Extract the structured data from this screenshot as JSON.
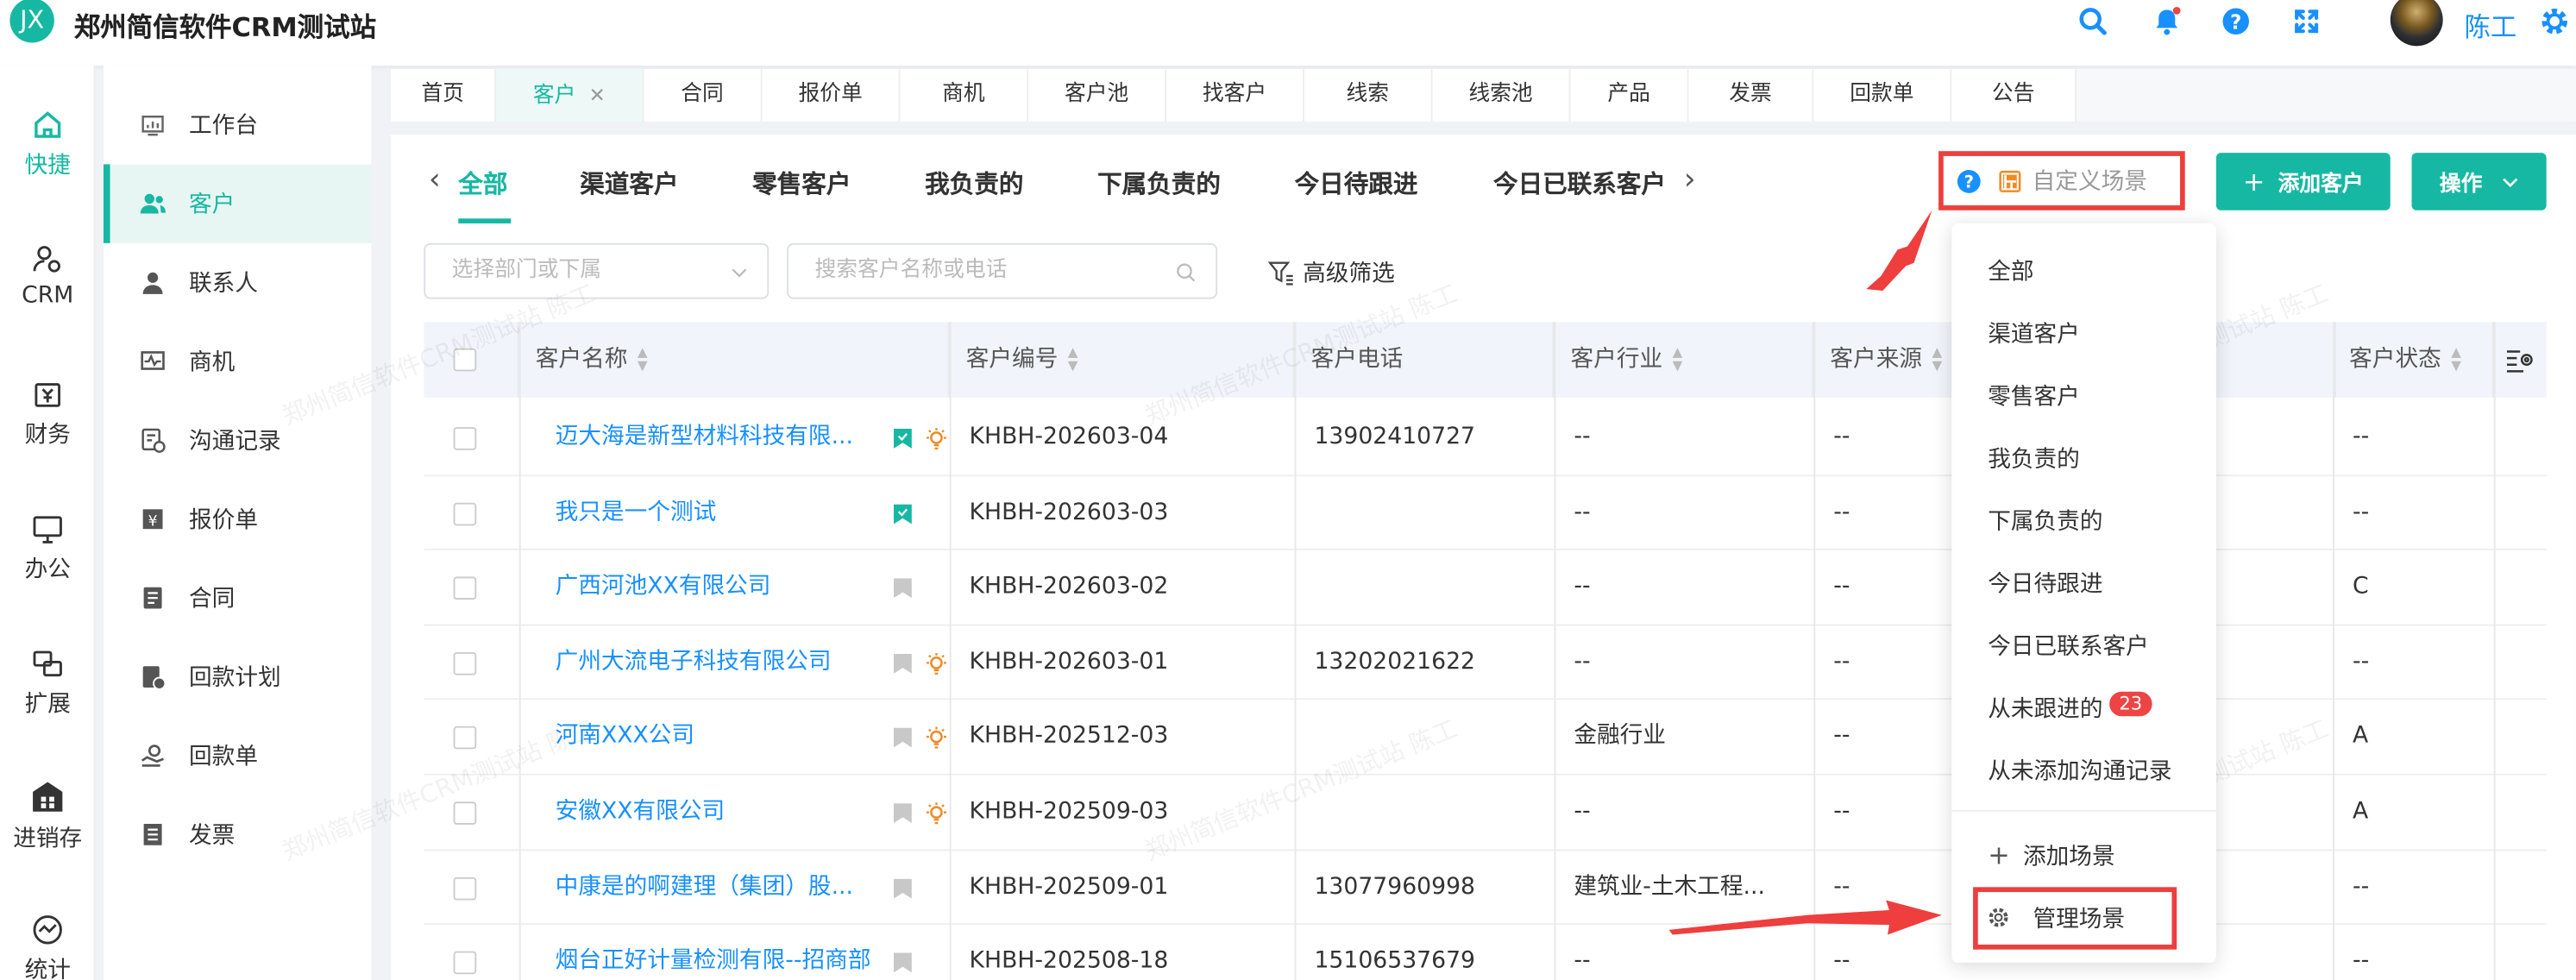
{
  "app": {
    "logo_text": "JX",
    "title": "郑州简信软件CRM测试站",
    "user_name": "陈工"
  },
  "rail": [
    {
      "label": "快捷",
      "icon": "home-icon"
    },
    {
      "label": "CRM",
      "icon": "crm-user-icon"
    },
    {
      "label": "财务",
      "icon": "finance-icon"
    },
    {
      "label": "办公",
      "icon": "monitor-icon"
    },
    {
      "label": "扩展",
      "icon": "extend-icon"
    },
    {
      "label": "进销存",
      "icon": "store-icon"
    },
    {
      "label": "统计",
      "icon": "stats-icon"
    }
  ],
  "menu": [
    {
      "label": "工作台"
    },
    {
      "label": "客户"
    },
    {
      "label": "联系人"
    },
    {
      "label": "商机"
    },
    {
      "label": "沟通记录"
    },
    {
      "label": "报价单"
    },
    {
      "label": "合同"
    },
    {
      "label": "回款计划"
    },
    {
      "label": "回款单"
    },
    {
      "label": "发票"
    }
  ],
  "tabs": [
    {
      "label": "首页"
    },
    {
      "label": "客户"
    },
    {
      "label": "合同"
    },
    {
      "label": "报价单"
    },
    {
      "label": "商机"
    },
    {
      "label": "客户池"
    },
    {
      "label": "找客户"
    },
    {
      "label": "线索"
    },
    {
      "label": "线索池"
    },
    {
      "label": "产品"
    },
    {
      "label": "发票"
    },
    {
      "label": "回款单"
    },
    {
      "label": "公告"
    }
  ],
  "scenes": [
    "全部",
    "渠道客户",
    "零售客户",
    "我负责的",
    "下属负责的",
    "今日待跟进",
    "今日已联系客户"
  ],
  "toolbar": {
    "custom_scene": "自定义场景",
    "add_customer": "添加客户",
    "actions": "操作"
  },
  "filters": {
    "dept_placeholder": "选择部门或下属",
    "search_placeholder": "搜索客户名称或电话",
    "advanced": "高级筛选"
  },
  "columns": [
    "客户名称",
    "客户编号",
    "客户电话",
    "客户行业",
    "客户来源",
    "客户状态"
  ],
  "rows": [
    {
      "name": "迈大海是新型材料科技有限...",
      "code": "KHBH-202603-04",
      "phone": "13902410727",
      "industry": "--",
      "source": "--",
      "status": "--",
      "flagged": true,
      "bulb": true
    },
    {
      "name": "我只是一个测试",
      "code": "KHBH-202603-03",
      "phone": "",
      "industry": "--",
      "source": "--",
      "status": "--",
      "flagged": true,
      "bulb": false
    },
    {
      "name": "广西河池XX有限公司",
      "code": "KHBH-202603-02",
      "phone": "",
      "industry": "--",
      "source": "--",
      "status": "C",
      "flagged": false,
      "bulb": false
    },
    {
      "name": "广州大流电子科技有限公司",
      "code": "KHBH-202603-01",
      "phone": "13202021622",
      "industry": "--",
      "source": "--",
      "status": "--",
      "flagged": false,
      "bulb": true
    },
    {
      "name": "河南XXX公司",
      "code": "KHBH-202512-03",
      "phone": "",
      "industry": "金融行业",
      "source": "--",
      "status": "A",
      "flagged": false,
      "bulb": true
    },
    {
      "name": "安徽XX有限公司",
      "code": "KHBH-202509-03",
      "phone": "",
      "industry": "--",
      "source": "--",
      "status": "A",
      "flagged": false,
      "bulb": true
    },
    {
      "name": "中康是的啊建理（集团）股...",
      "code": "KHBH-202509-01",
      "phone": "13077960998",
      "industry": "建筑业-土木工程...",
      "source": "--",
      "status": "--",
      "flagged": false,
      "bulb": false
    },
    {
      "name": "烟台正好计量检测有限--招商部",
      "code": "KHBH-202508-18",
      "phone": "15106537679",
      "industry": "--",
      "source": "--",
      "status": "--",
      "flagged": false,
      "bulb": false
    }
  ],
  "dropdown": {
    "items": [
      "全部",
      "渠道客户",
      "零售客户",
      "我负责的",
      "下属负责的",
      "今日待跟进",
      "今日已联系客户",
      "从未跟进的",
      "从未添加沟通记录"
    ],
    "never_followed_badge": "23",
    "add_scene": "添加场景",
    "manage_scene": "管理场景"
  },
  "watermark": "郑州简信软件CRM测试站 陈工",
  "colors": {
    "brand": "#17b8a3",
    "link": "#1890ff",
    "annotation": "#ee3e3e"
  }
}
